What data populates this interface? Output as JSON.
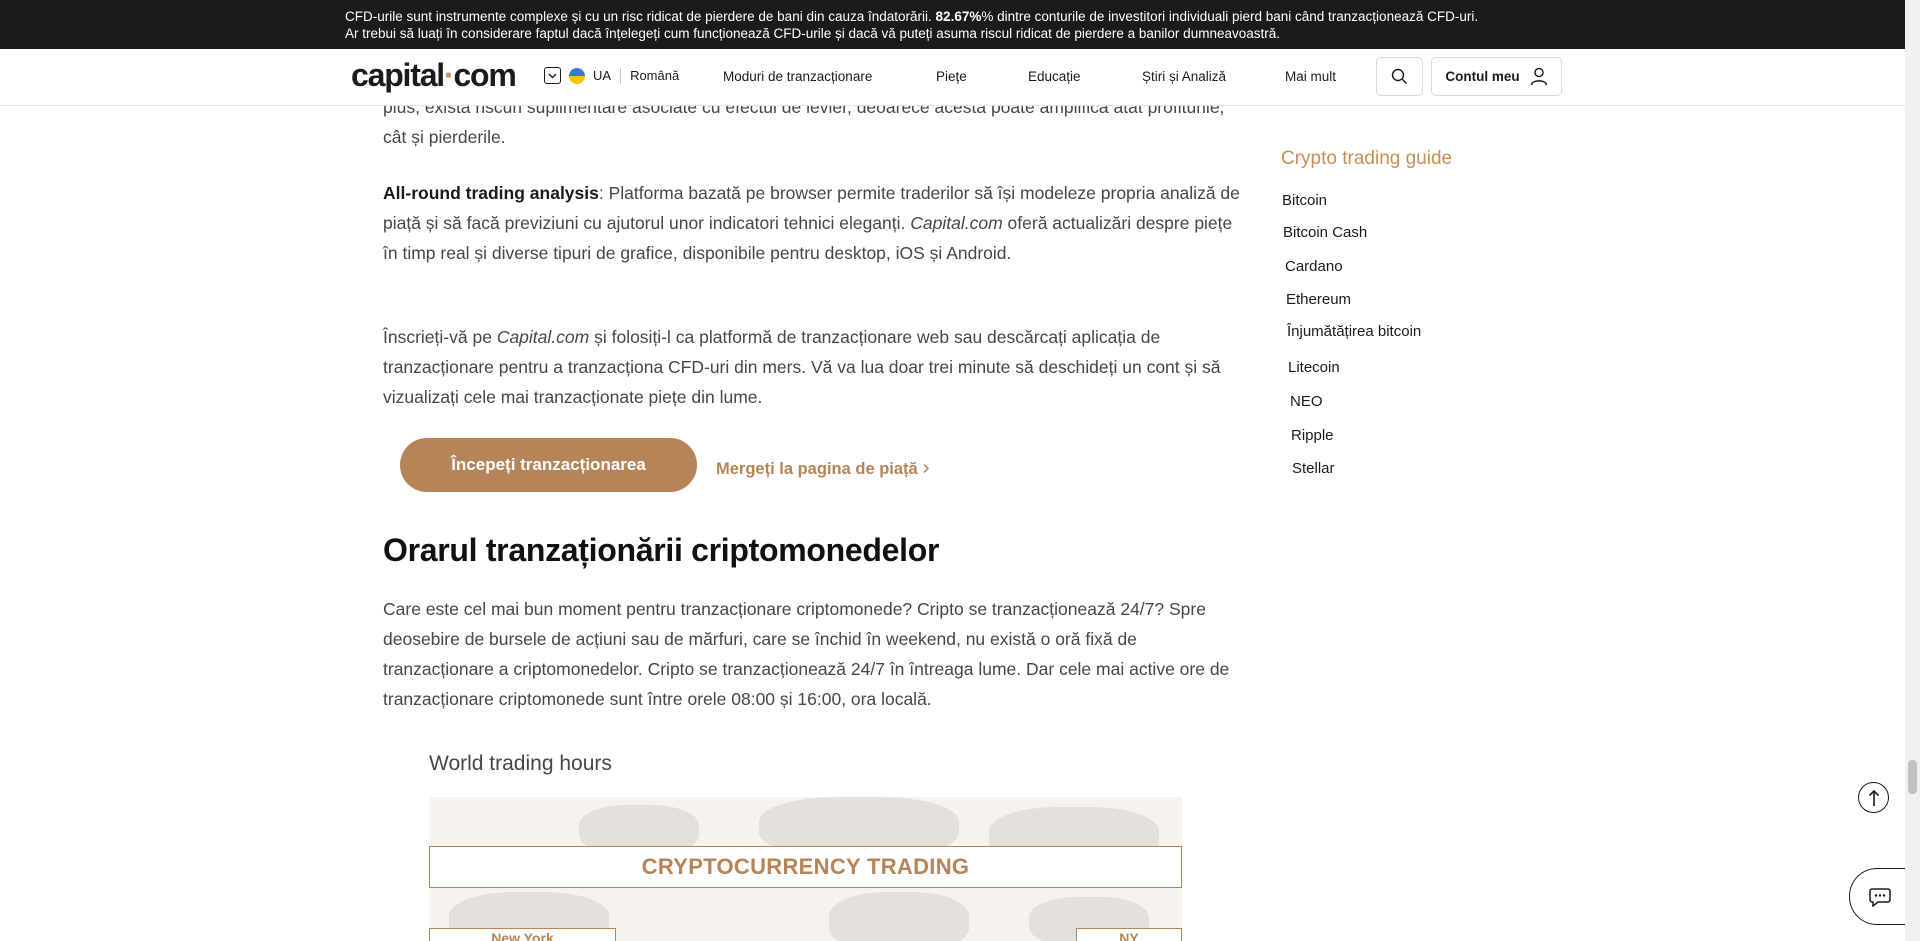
{
  "risk_banner": {
    "line1_prefix": "CFD-urile sunt instrumente complexe și cu un risc ridicat de pierdere de bani din cauza îndatorării.",
    "percentage": "82.67%",
    "line1_suffix": "% dintre conturile de investitori individuali pierd bani când tranzacționează CFD-uri.",
    "line2": "Ar trebui să luați în considerare faptul dacă înțelegeți cum funcționează CFD-urile și dacă vă puteți asuma riscul ridicat de pierdere a banilor dumneavoastră."
  },
  "header": {
    "logo_main": "capital",
    "logo_dot": "·",
    "logo_end": "com",
    "region": "UA",
    "language": "Română",
    "nav": [
      "Moduri de tranzacționare",
      "Piețe",
      "Educație",
      "Știri și Analiză",
      "Mai mult"
    ],
    "account_label": "Contul meu"
  },
  "article": {
    "p0": "plus, există riscuri suplimentare asociate cu efectul de levier, deoarece acesta poate amplifica atât profiturile, cât și pierderile.",
    "p1_bold": "All-round trading analysis",
    "p1_a": ": Platforma bazată pe browser permite traderilor să își modeleze propria analiză de piață și să facă previziuni cu ajutorul unor indicatori tehnici eleganți.",
    "p1_brand": "Capital.com",
    "p1_b": "oferă actualizări despre piețe în timp real și diverse tipuri de grafice, disponibile pentru desktop, iOS și Android.",
    "p2_a": "Înscrieți-vă pe",
    "p2_brand": "Capital.com",
    "p2_b": "și folosiți-l ca platformă de tranzacționare web sau descărcați aplicația de tranzacționare pentru a tranzacționa CFD-uri din mers. Vă va lua doar trei minute să deschideți un cont și să vizualizați cele mai tranzacționate piețe din lume.",
    "cta_label": "Începeți tranzacționarea",
    "market_link": "Mergeți la pagina de piață",
    "heading": "Orarul tranzaționării criptomonedelor",
    "p3": "Care este cel mai bun moment pentru tranzacționare criptomonede? Cripto se tranzacționează 24/7? Spre deosebire de bursele de acțiuni sau de mărfuri, care se închid în weekend, nu există o oră fixă de tranzacționare a criptomonedelor. Cripto se tranzacționează 24/7 în întreaga lume. Dar cele mai active ore de tranzacționare criptomonede sunt între orele 08:00 și 16:00, ora locală.",
    "image": {
      "title": "World trading hours",
      "band": "CRYPTOCURRENCY TRADING",
      "city_left": "New York",
      "city_right": "NY"
    }
  },
  "sidebar": {
    "title": "Crypto trading guide",
    "items": [
      "Bitcoin",
      "Bitcoin Cash",
      "Cardano",
      "Ethereum",
      "Înjumătățirea bitcoin",
      "Litecoin",
      "NEO",
      "Ripple",
      "Stellar"
    ]
  },
  "colors": {
    "accent": "#b58458",
    "accent_light": "#c78e55",
    "banner_bg": "#1c1b19"
  },
  "icons": {
    "search": "search-icon",
    "account": "user-icon",
    "scroll_top": "arrow-up-icon",
    "chat": "chat-icon",
    "region_toggle": "chevron-down-icon",
    "link_arrow": "chevron-right-icon"
  }
}
